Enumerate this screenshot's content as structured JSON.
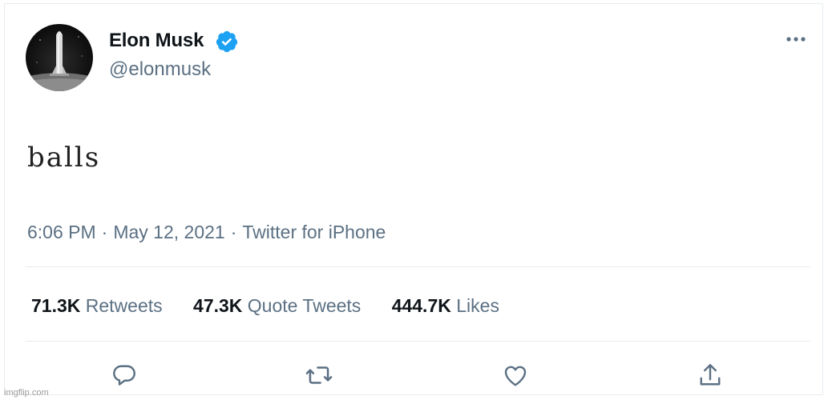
{
  "author": {
    "name": "Elon Musk",
    "handle": "@elonmusk",
    "verified": true,
    "avatar_icon": "starship-rocket-avatar"
  },
  "menu_icon": "more-options-icon",
  "tweet": {
    "text": "balls",
    "time": "6:06 PM",
    "date": "May 12, 2021",
    "source": "Twitter for iPhone",
    "separator": "·"
  },
  "stats": [
    {
      "value": "71.3K",
      "label": "Retweets"
    },
    {
      "value": "47.3K",
      "label": "Quote Tweets"
    },
    {
      "value": "444.7K",
      "label": "Likes"
    }
  ],
  "actions": [
    "reply-icon",
    "retweet-icon",
    "like-icon",
    "share-icon"
  ],
  "colors": {
    "text": "#0f1419",
    "secondary": "#5b7083",
    "verified": "#1da1f2",
    "divider": "#e6ecf0"
  },
  "watermark": "imgflip.com"
}
